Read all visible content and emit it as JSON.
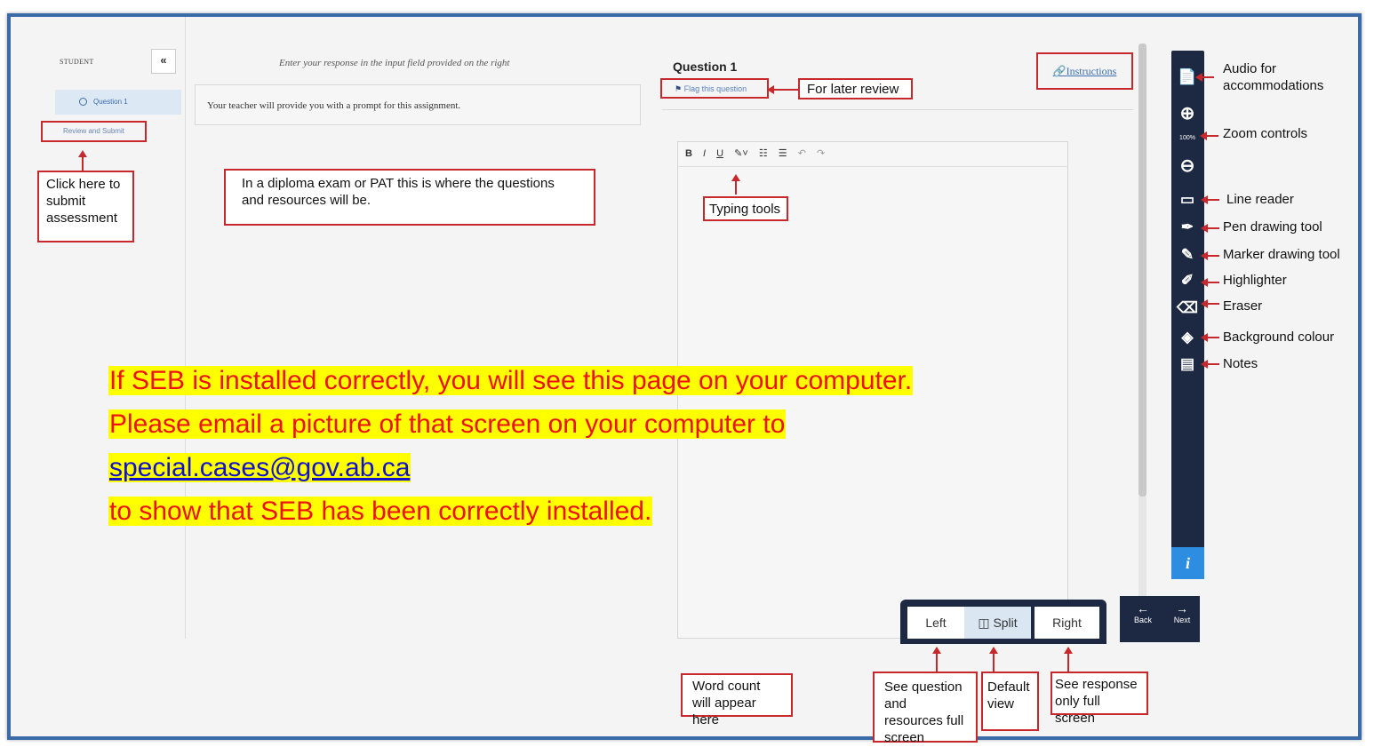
{
  "sidebar": {
    "student_label": "STUDENT",
    "collapse_icon": "«",
    "question_item": "Question 1",
    "review_submit": "Review and Submit"
  },
  "question_panel": {
    "instruction": "Enter your response in the input field provided on the right",
    "prompt": "Your teacher will provide you with a prompt for this assignment."
  },
  "response_panel": {
    "title": "Question 1",
    "flag_label": "Flag this question",
    "instructions_link": "Instructions",
    "toolbar": [
      "B",
      "I",
      "U",
      "✎˅",
      "☷",
      "☰",
      "↶",
      "↷"
    ]
  },
  "tools": [
    {
      "icon": "audio-icon",
      "glyph": "📄",
      "label": "Audio for accommodations"
    },
    {
      "icon": "zoom-in-icon",
      "glyph": "⊕",
      "label": "Zoom controls"
    },
    {
      "icon": "zoom-out-icon",
      "glyph": "⊖",
      "label": ""
    },
    {
      "icon": "line-reader-icon",
      "glyph": "▭",
      "label": "Line reader"
    },
    {
      "icon": "pen-icon",
      "glyph": "✒",
      "label": "Pen drawing tool"
    },
    {
      "icon": "marker-icon",
      "glyph": "✎",
      "label": "Marker drawing tool"
    },
    {
      "icon": "highlighter-icon",
      "glyph": "✐",
      "label": "Highlighter"
    },
    {
      "icon": "eraser-icon",
      "glyph": "⌫",
      "label": "Eraser"
    },
    {
      "icon": "background-colour-icon",
      "glyph": "◈",
      "label": "Background colour"
    },
    {
      "icon": "notes-icon",
      "glyph": "▤",
      "label": "Notes"
    }
  ],
  "zoom_level": "100%",
  "info_icon": "i",
  "nav": {
    "back": "Back",
    "next": "Next"
  },
  "view_buttons": {
    "left": "Left",
    "split": "Split",
    "right": "Right"
  },
  "callouts": {
    "submit": "Click here to submit assessment",
    "diploma": "In a diploma exam or PAT this is where the questions and resources will be.",
    "typing": "Typing tools",
    "flag": "For later review",
    "word_count": "Word count will appear here",
    "left_view": "See question and resources full screen",
    "split_view": "Default view",
    "right_view": "See response only full screen"
  },
  "notice": {
    "line1": "If SEB is installed correctly, you will see this page on your computer.",
    "line2": "Please email a picture of that screen on your computer to",
    "email": "special.cases@gov.ab.ca",
    "line4": "to show that SEB has been correctly installed."
  },
  "colors": {
    "annotation_red": "#c8282b",
    "toolbar_navy": "#1d2942",
    "highlight": "#ffff00",
    "notice_text": "#ee1111"
  }
}
